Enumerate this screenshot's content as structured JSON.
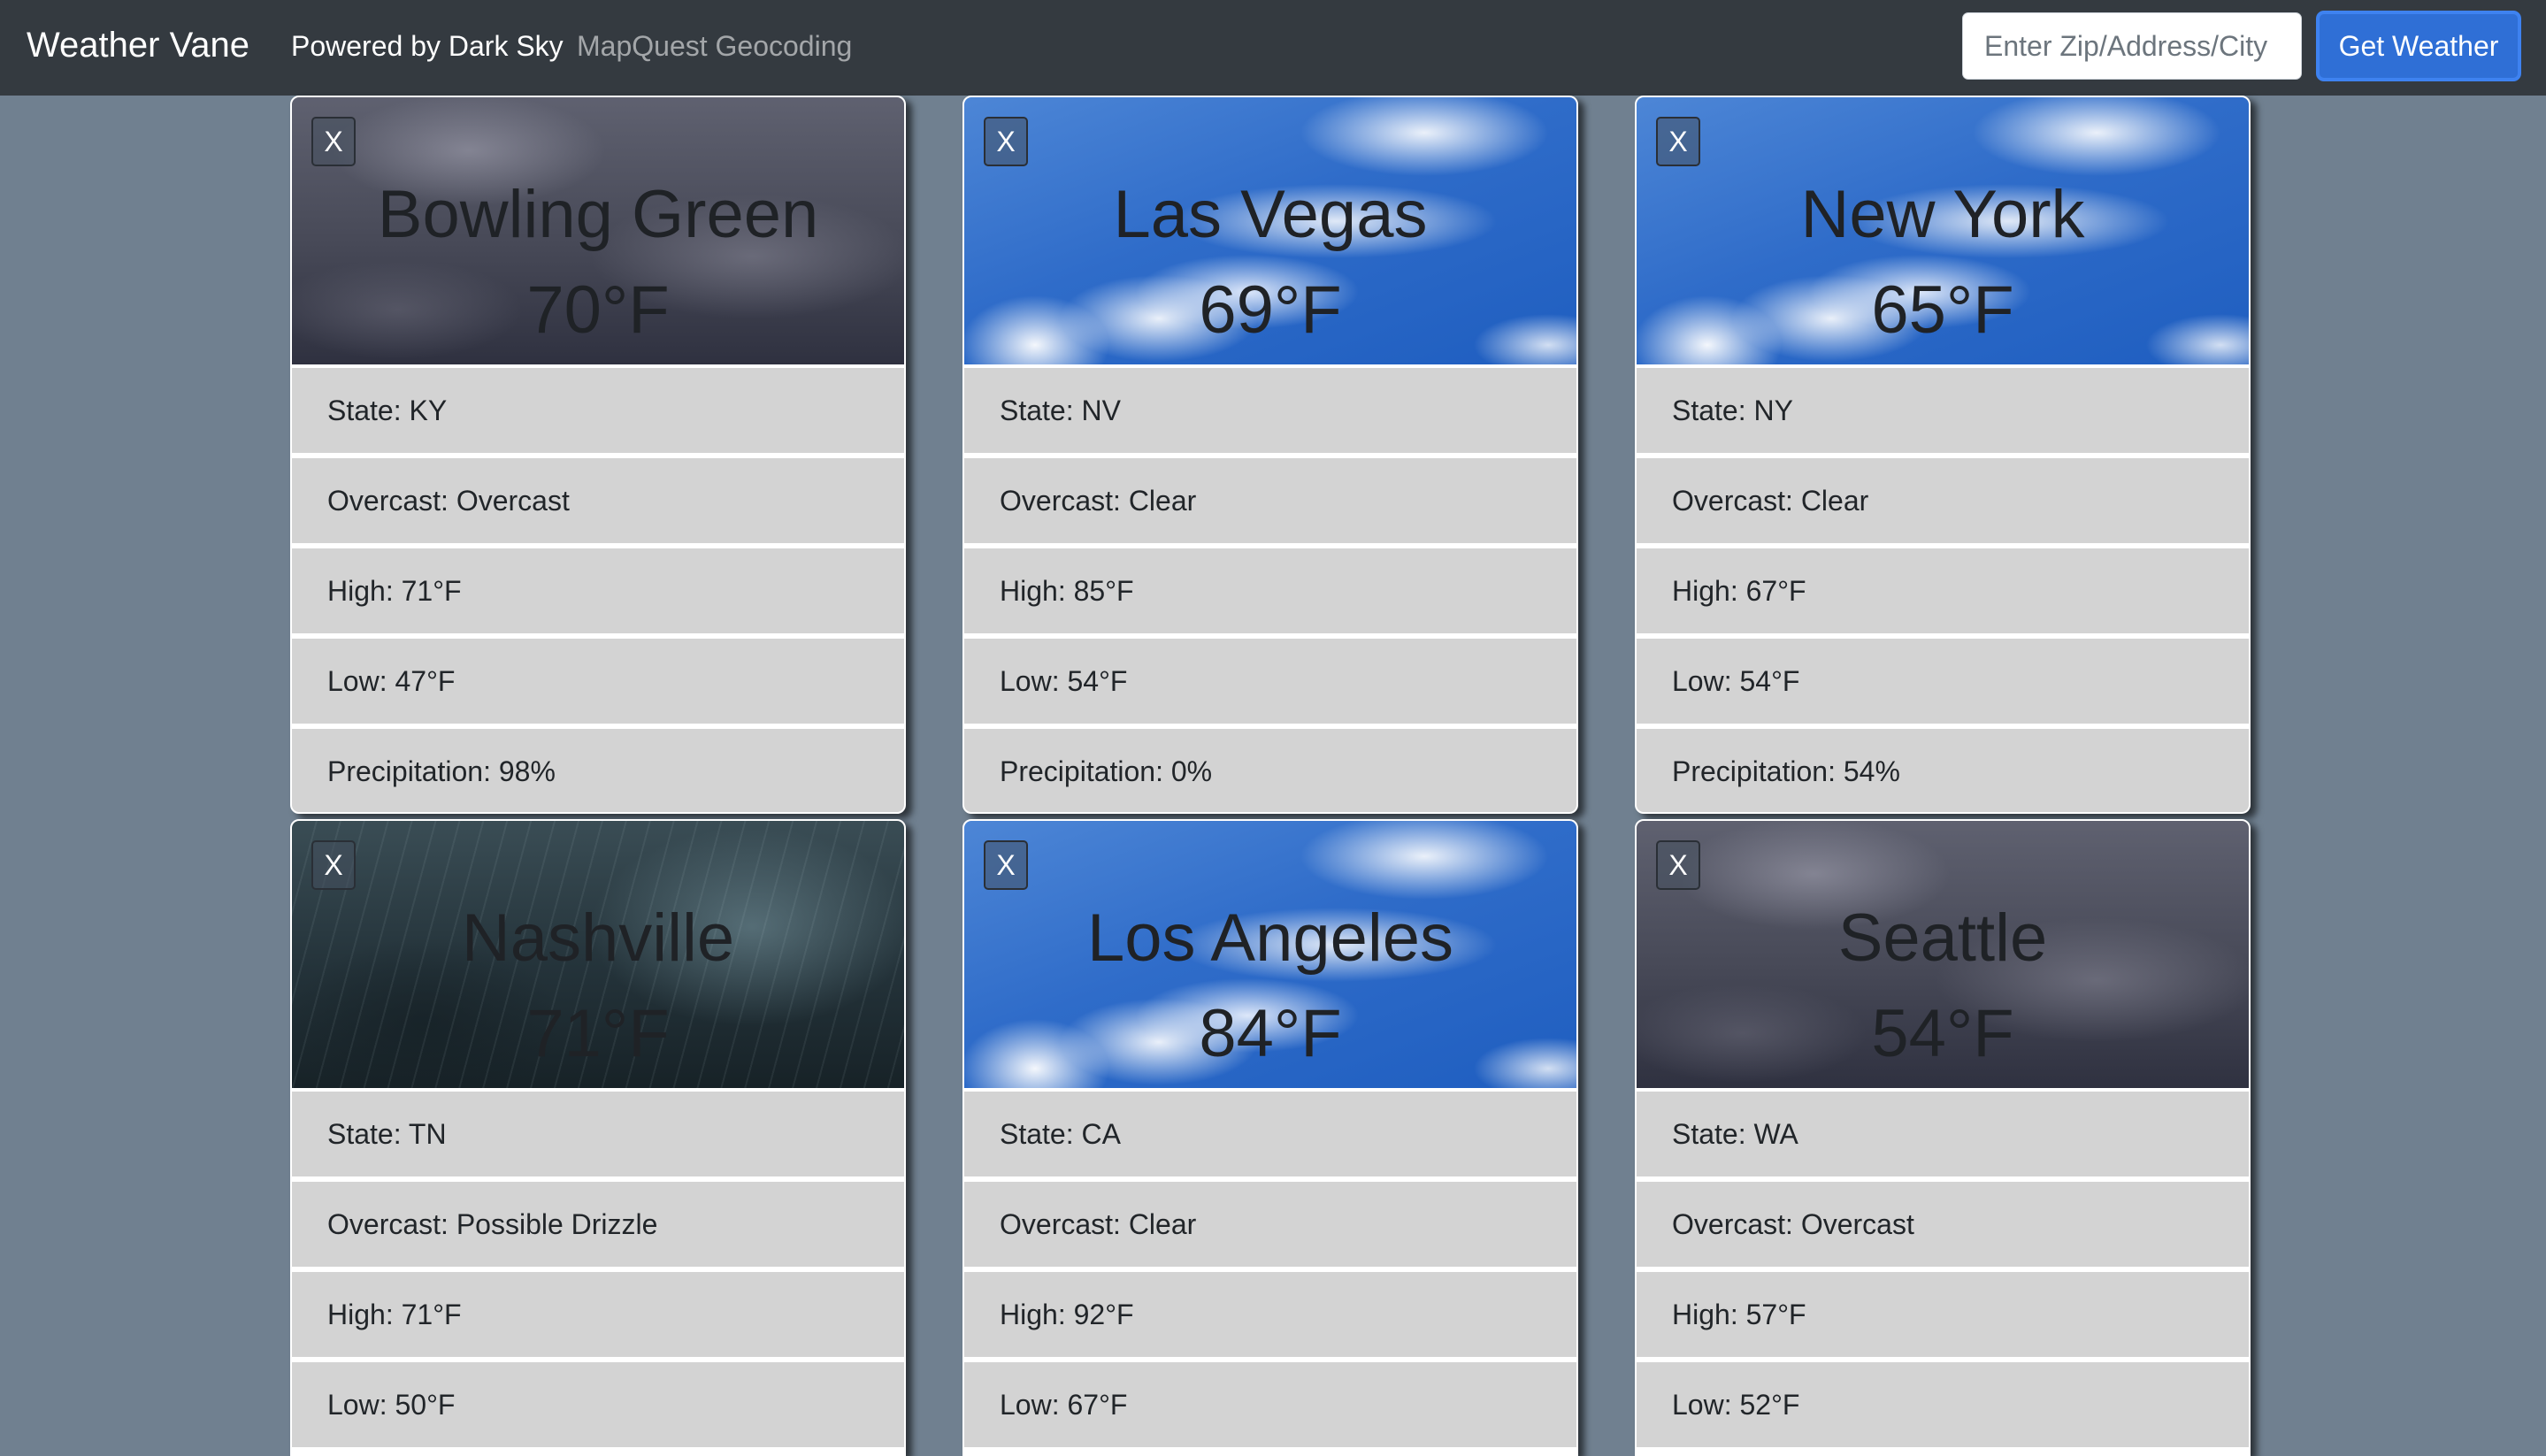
{
  "navbar": {
    "brand": "Weather Vane",
    "links": [
      "Powered by Dark Sky",
      "MapQuest Geocoding"
    ],
    "search_placeholder": "Enter Zip/Address/City",
    "submit_label": "Get Weather"
  },
  "cards": [
    {
      "city": "Bowling Green",
      "temp": "70°F",
      "close_label": "X",
      "background": "overcast",
      "details": [
        "State: KY",
        "Overcast: Overcast",
        "High: 71°F",
        "Low: 47°F",
        "Precipitation: 98%"
      ]
    },
    {
      "city": "Las Vegas",
      "temp": "69°F",
      "close_label": "X",
      "background": "clear-sky",
      "details": [
        "State: NV",
        "Overcast: Clear",
        "High: 85°F",
        "Low: 54°F",
        "Precipitation: 0%"
      ]
    },
    {
      "city": "New York",
      "temp": "65°F",
      "close_label": "X",
      "background": "clear-sky",
      "details": [
        "State: NY",
        "Overcast: Clear",
        "High: 67°F",
        "Low: 54°F",
        "Precipitation: 54%"
      ]
    },
    {
      "city": "Nashville",
      "temp": "71°F",
      "close_label": "X",
      "background": "rain",
      "details": [
        "State: TN",
        "Overcast: Possible Drizzle",
        "High: 71°F",
        "Low: 50°F"
      ]
    },
    {
      "city": "Los Angeles",
      "temp": "84°F",
      "close_label": "X",
      "background": "clear-sky",
      "details": [
        "State: CA",
        "Overcast: Clear",
        "High: 92°F",
        "Low: 67°F"
      ]
    },
    {
      "city": "Seattle",
      "temp": "54°F",
      "close_label": "X",
      "background": "overcast",
      "details": [
        "State: WA",
        "Overcast: Overcast",
        "High: 57°F",
        "Low: 52°F"
      ]
    }
  ],
  "colors": {
    "page_background": "#708090",
    "navbar_background": "#343a40",
    "button_primary": "#2f6fd6",
    "list_item_background": "#d3d3d3"
  }
}
